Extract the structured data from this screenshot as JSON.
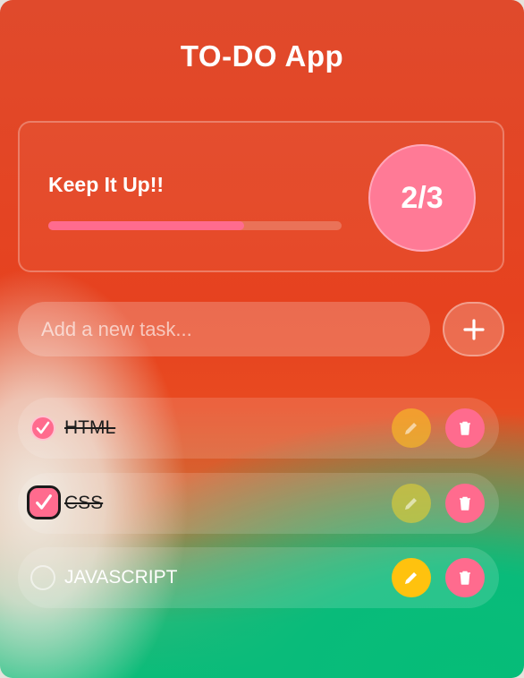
{
  "app": {
    "title": "TO-DO App"
  },
  "stats": {
    "label": "Keep It Up!!",
    "counter": "2/3",
    "progress_fraction": 0.667
  },
  "input": {
    "placeholder": "Add a new task...",
    "value": ""
  },
  "add_button": {
    "icon": "plus-icon"
  },
  "tasks": [
    {
      "label": "HTML",
      "completed": true
    },
    {
      "label": "CSS",
      "completed": true
    },
    {
      "label": "JAVASCRIPT",
      "completed": false
    }
  ],
  "icons": {
    "edit": "pencil-icon",
    "delete": "trash-icon",
    "check": "check-icon"
  },
  "colors": {
    "accent_pink": "#ff6b8e",
    "edit_yellow": "#ffc20e",
    "background_red": "#e6421f",
    "background_green": "#0bbc78"
  }
}
